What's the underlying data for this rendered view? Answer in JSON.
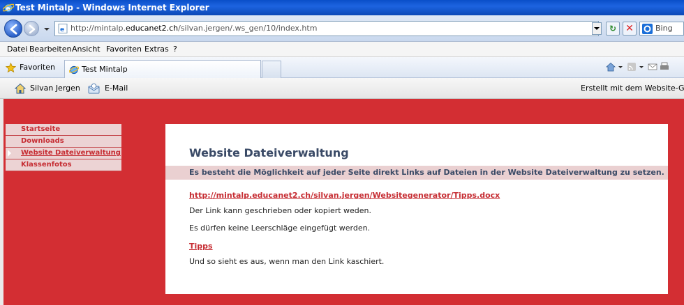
{
  "browser": {
    "window_title": "Test Mintalp - Windows Internet Explorer",
    "url_prefix": "http://mintalp.",
    "url_domain": "educanet2.ch",
    "url_path": "/silvan.jergen/.ws_gen/10/index.htm",
    "search_engine": "Bing",
    "menu": [
      "Datei",
      "Bearbeiten",
      "Ansicht",
      "Favoriten",
      "Extras",
      "?"
    ],
    "favorites_label": "Favoriten",
    "tab_title": "Test Mintalp"
  },
  "site_toolbar": {
    "name": "Silvan Jergen",
    "email_label": "E-Mail",
    "created_with": "Erstellt mit dem Website-Ge"
  },
  "nav": {
    "items": [
      {
        "label": "Startseite"
      },
      {
        "label": "Downloads"
      },
      {
        "label": "Website Dateiverwaltung"
      },
      {
        "label": "Klassenfotos"
      }
    ]
  },
  "content": {
    "heading": "Website Dateiverwaltung",
    "banner": "Es besteht die Möglichkeit auf jeder Seite direkt Links auf Dateien in der Website Dateiverwaltung zu setzen.",
    "link_url": "http://mintalp.educanet2.ch/silvan.jergen/Websitegenerator/Tipps.docx",
    "text1": "Der Link kann geschrieben oder kopiert weden.",
    "text2": "Es dürfen keine Leerschläge eingefügt werden.",
    "link_short": "Tipps",
    "text3": "Und so sieht es aus, wenn man den Link kaschiert."
  },
  "colors": {
    "page_background": "#d32e33",
    "nav_item_background": "#ecd3d4",
    "link": "#c62d33",
    "heading": "#3a4a66"
  }
}
